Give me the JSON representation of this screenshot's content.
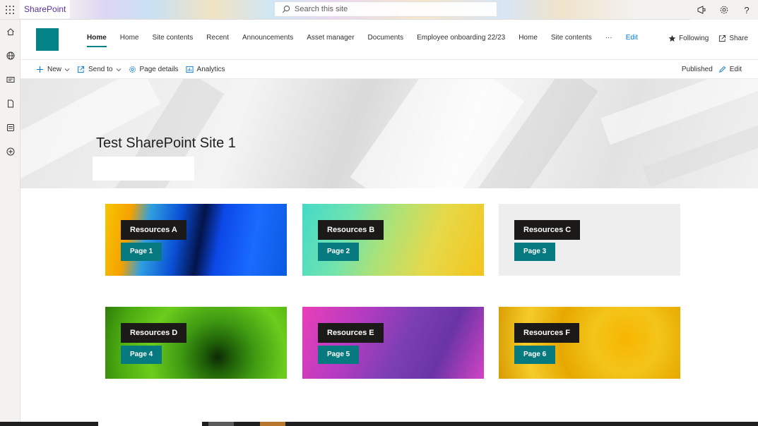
{
  "suite": {
    "app_name": "SharePoint",
    "search_placeholder": "Search this site",
    "icons": [
      "megaphone-icon",
      "gear-icon",
      "help-icon"
    ],
    "help_glyph": "?"
  },
  "rail": {
    "icons": [
      "home-icon",
      "globe-icon",
      "news-icon",
      "file-icon",
      "list-icon",
      "add-circle-icon"
    ]
  },
  "site": {
    "logo_color": "#038387",
    "nav": [
      {
        "label": "Home",
        "active": true
      },
      {
        "label": "Home"
      },
      {
        "label": "Site contents"
      },
      {
        "label": "Recent"
      },
      {
        "label": "Announcements"
      },
      {
        "label": "Asset manager"
      },
      {
        "label": "Documents"
      },
      {
        "label": "Employee onboarding 22/23"
      },
      {
        "label": "Home"
      },
      {
        "label": "Site contents"
      },
      {
        "label": "···"
      },
      {
        "label": "Edit",
        "edit": true
      }
    ],
    "following_label": "Following",
    "share_label": "Share"
  },
  "commandbar": {
    "new_label": "New",
    "send_to_label": "Send to",
    "page_details_label": "Page details",
    "analytics_label": "Analytics",
    "published_label": "Published",
    "edit_label": "Edit"
  },
  "hero": {
    "title": "Test SharePoint Site 1"
  },
  "tiles": [
    {
      "title": "Resources A",
      "button": "Page 1",
      "bg": "colorful-blue-yellow"
    },
    {
      "title": "Resources B",
      "button": "Page 2",
      "bg": "teal-yellow-gradient"
    },
    {
      "title": "Resources C",
      "button": "Page 3",
      "bg": "light-gray"
    },
    {
      "title": "Resources D",
      "button": "Page 4",
      "bg": "green-leaf"
    },
    {
      "title": "Resources E",
      "button": "Page 5",
      "bg": "pink-purple"
    },
    {
      "title": "Resources F",
      "button": "Page 6",
      "bg": "yellow-flower"
    }
  ],
  "colors": {
    "accent": "#038387",
    "tile_button": "#077a7f",
    "tile_title": "#1b1a19",
    "link": "#0078d4",
    "brand": "#5b2fa2"
  }
}
